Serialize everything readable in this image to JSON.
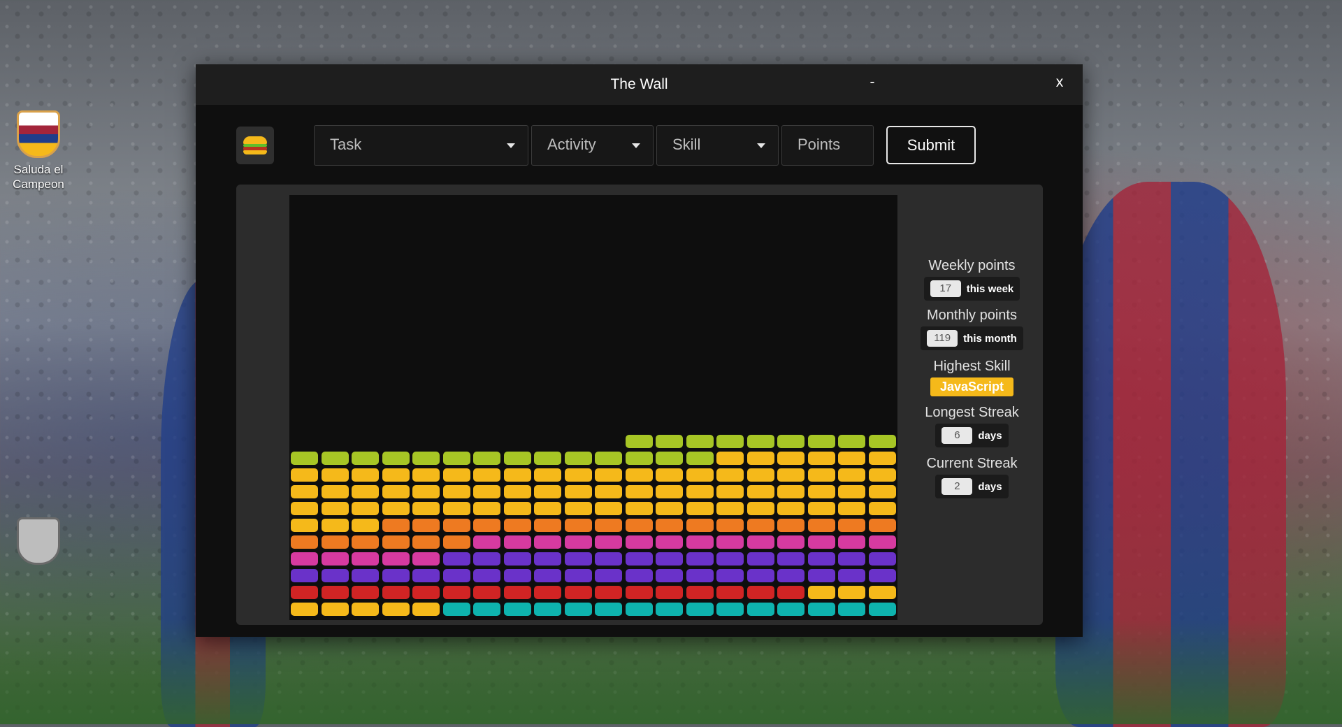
{
  "desktop": {
    "icons": [
      {
        "name": "Saluda el Campeon"
      },
      {
        "name": ""
      }
    ]
  },
  "window": {
    "title": "The Wall",
    "minimize_label": "-",
    "close_label": "x"
  },
  "toolbar": {
    "menu_icon": "hamburger-burger-icon",
    "task_placeholder": "Task",
    "activity_placeholder": "Activity",
    "skill_placeholder": "Skill",
    "points_placeholder": "Points",
    "submit_label": "Submit"
  },
  "wall": {
    "colors": {
      "lime": "#a7c625",
      "yellow": "#f5b91a",
      "orange": "#ee7a21",
      "pink": "#d63aa0",
      "purple": "#6a32c9",
      "red": "#d12424",
      "teal": "#0eb3ae"
    },
    "rows_bottom_to_top": [
      [
        "yellow",
        "yellow",
        "yellow",
        "yellow",
        "yellow",
        "teal",
        "teal",
        "teal",
        "teal",
        "teal",
        "teal",
        "teal",
        "teal",
        "teal",
        "teal",
        "teal",
        "teal",
        "teal",
        "teal",
        "teal"
      ],
      [
        "red",
        "red",
        "red",
        "red",
        "red",
        "red",
        "red",
        "red",
        "red",
        "red",
        "red",
        "red",
        "red",
        "red",
        "red",
        "red",
        "red",
        "yellow",
        "yellow",
        "yellow"
      ],
      [
        "purple",
        "purple",
        "purple",
        "purple",
        "purple",
        "purple",
        "purple",
        "purple",
        "purple",
        "purple",
        "purple",
        "purple",
        "purple",
        "purple",
        "purple",
        "purple",
        "purple",
        "purple",
        "purple",
        "purple"
      ],
      [
        "pink",
        "pink",
        "pink",
        "pink",
        "pink",
        "purple",
        "purple",
        "purple",
        "purple",
        "purple",
        "purple",
        "purple",
        "purple",
        "purple",
        "purple",
        "purple",
        "purple",
        "purple",
        "purple",
        "purple"
      ],
      [
        "orange",
        "orange",
        "orange",
        "orange",
        "orange",
        "orange",
        "pink",
        "pink",
        "pink",
        "pink",
        "pink",
        "pink",
        "pink",
        "pink",
        "pink",
        "pink",
        "pink",
        "pink",
        "pink",
        "pink"
      ],
      [
        "yellow",
        "yellow",
        "yellow",
        "orange",
        "orange",
        "orange",
        "orange",
        "orange",
        "orange",
        "orange",
        "orange",
        "orange",
        "orange",
        "orange",
        "orange",
        "orange",
        "orange",
        "orange",
        "orange",
        "orange"
      ],
      [
        "yellow",
        "yellow",
        "yellow",
        "yellow",
        "yellow",
        "yellow",
        "yellow",
        "yellow",
        "yellow",
        "yellow",
        "yellow",
        "yellow",
        "yellow",
        "yellow",
        "yellow",
        "yellow",
        "yellow",
        "yellow",
        "yellow",
        "yellow"
      ],
      [
        "yellow",
        "yellow",
        "yellow",
        "yellow",
        "yellow",
        "yellow",
        "yellow",
        "yellow",
        "yellow",
        "yellow",
        "yellow",
        "yellow",
        "yellow",
        "yellow",
        "yellow",
        "yellow",
        "yellow",
        "yellow",
        "yellow",
        "yellow"
      ],
      [
        "yellow",
        "yellow",
        "yellow",
        "yellow",
        "yellow",
        "yellow",
        "yellow",
        "yellow",
        "yellow",
        "yellow",
        "yellow",
        "yellow",
        "yellow",
        "yellow",
        "yellow",
        "yellow",
        "yellow",
        "yellow",
        "yellow",
        "yellow"
      ],
      [
        "lime",
        "lime",
        "lime",
        "lime",
        "lime",
        "lime",
        "lime",
        "lime",
        "lime",
        "lime",
        "lime",
        "lime",
        "lime",
        "lime",
        "yellow",
        "yellow",
        "yellow",
        "yellow",
        "yellow",
        "yellow"
      ],
      [
        null,
        null,
        null,
        null,
        null,
        null,
        null,
        null,
        null,
        null,
        null,
        "lime",
        "lime",
        "lime",
        "lime",
        "lime",
        "lime",
        "lime",
        "lime",
        "lime"
      ]
    ]
  },
  "stats": {
    "weekly_label": "Weekly points",
    "weekly_value": "17",
    "weekly_unit": "this week",
    "monthly_label": "Monthly points",
    "monthly_value": "119",
    "monthly_unit": "this month",
    "highest_skill_label": "Highest Skill",
    "highest_skill_value": "JavaScript",
    "longest_streak_label": "Longest Streak",
    "longest_streak_value": "6",
    "longest_streak_unit": "days",
    "current_streak_label": "Current Streak",
    "current_streak_value": "2",
    "current_streak_unit": "days"
  }
}
